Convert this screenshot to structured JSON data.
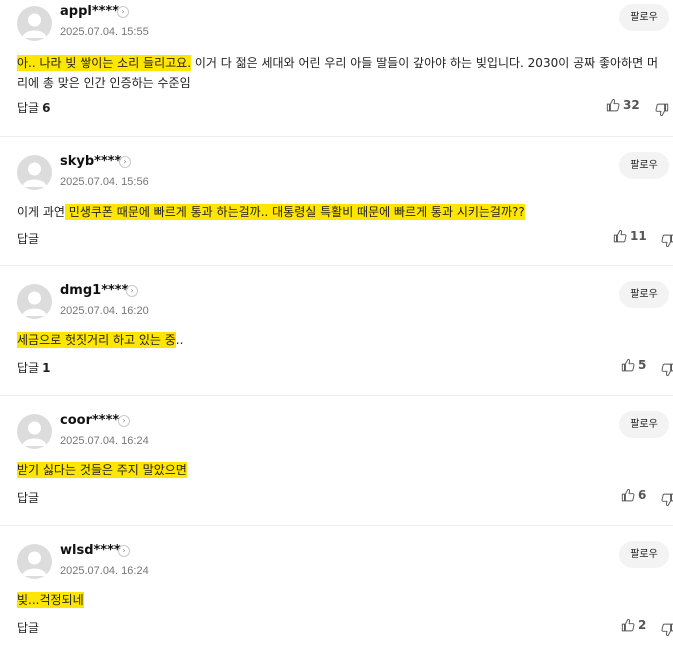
{
  "follow_label": "팔로우",
  "reply_label": "답글",
  "comments": [
    {
      "username": "appl****",
      "timestamp": "2025.07.04. 15:55",
      "text_highlight": "아.. 나라 빚 쌓이는 소리 들리고요.",
      "text_rest": " 이거 다 젊은 세대와 어린 우리 아들 딸들이 갚아야 하는 빚입니다. 2030이 공짜 좋아하면 머리에 총 맞은 인간 인증하는 수준임",
      "reply_count": "6",
      "likes": "32"
    },
    {
      "username": "skyb****",
      "timestamp": "2025.07.04. 15:56",
      "text_prefix": "이게 과연",
      "text_highlight": " 민생쿠폰 때문에 빠르게 통과 하는걸까.. 대통령실 특활비 때문에 빠르게 통과 시키는걸까??",
      "reply_count": "",
      "likes": "11"
    },
    {
      "username": "dmg1****",
      "timestamp": "2025.07.04. 16:20",
      "text_highlight": "세금으로 헛짓거리 하고 있는 중",
      "text_rest": "..",
      "reply_count": "1",
      "likes": "5"
    },
    {
      "username": "coor****",
      "timestamp": "2025.07.04. 16:24",
      "text_highlight": "받기 싫다는 것들은 주지 말았으면",
      "reply_count": "",
      "likes": "6"
    },
    {
      "username": "wlsd****",
      "timestamp": "2025.07.04. 16:24",
      "text_highlight": "빚...걱정되네",
      "reply_count": "",
      "likes": "2"
    }
  ]
}
